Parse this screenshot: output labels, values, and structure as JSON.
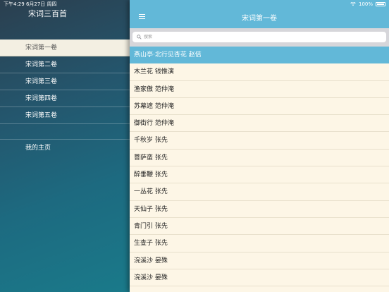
{
  "status_bar": {
    "time_date": "下午4:29   6月27日 周四",
    "battery": "100%"
  },
  "sidebar": {
    "title": "宋词三百首",
    "items": [
      {
        "label": "宋词第一卷",
        "active": true
      },
      {
        "label": "宋词第二卷",
        "active": false
      },
      {
        "label": "宋词第三卷",
        "active": false
      },
      {
        "label": "宋词第四卷",
        "active": false
      },
      {
        "label": "宋词第五卷",
        "active": false
      }
    ],
    "home_label": "我的主页"
  },
  "nav": {
    "title": "宋词第一卷"
  },
  "search": {
    "placeholder": "搜索"
  },
  "poems": [
    {
      "label": "燕山亭·北行见杏花  赵佶",
      "selected": true
    },
    {
      "label": "木兰花  钱惟演"
    },
    {
      "label": "渔家傲  范仲淹"
    },
    {
      "label": "苏幕遮  范仲淹"
    },
    {
      "label": "御街行  范仲淹"
    },
    {
      "label": "千秋岁  张先"
    },
    {
      "label": "菩萨蛮  张先"
    },
    {
      "label": "醉垂鞭  张先"
    },
    {
      "label": "一丛花  张先"
    },
    {
      "label": "天仙子  张先"
    },
    {
      "label": "青门引  张先"
    },
    {
      "label": "生查子  张先"
    },
    {
      "label": "浣溪沙  晏殊"
    },
    {
      "label": "浣溪沙  晏殊"
    }
  ],
  "colors": {
    "nav_bar": "#62b8d8",
    "list_background": "#fdf6e6",
    "sidebar_active": "#f3efe2"
  }
}
